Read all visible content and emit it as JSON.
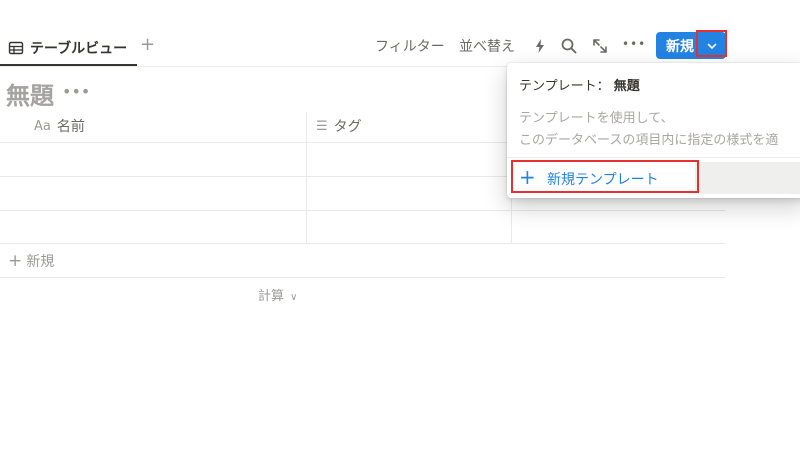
{
  "toolbar": {
    "tab_label": "テーブルビュー",
    "add_view": "+",
    "filter": "フィルター",
    "sort": "並べ替え",
    "new_button": "新規",
    "more": "•••"
  },
  "page": {
    "title": "無題",
    "title_more": "•••"
  },
  "table": {
    "columns": [
      {
        "prefix": "Aa",
        "label": "名前"
      },
      {
        "prefix": "☰",
        "label": "タグ"
      }
    ],
    "new_row_plus": "+",
    "new_row_label": "新規",
    "calculate_label": "計算",
    "calculate_chevron": "∨"
  },
  "template_menu": {
    "head_prefix": "テンプレート：",
    "head_name": "無題",
    "desc_line1": "テンプレートを使用して、",
    "desc_line2": "このデータベースの項目内に指定の様式を適",
    "new_plus": "+",
    "new_template_label": "新規テンプレート"
  },
  "colors": {
    "accent": "#2383e2",
    "highlight": "#e63030",
    "text": "#37352f",
    "muted": "#9b9a97"
  },
  "icons": {
    "tab": "table-icon",
    "automation": "lightning-icon",
    "search": "search-icon",
    "expand": "expand-icon",
    "caret": "chevron-down-icon",
    "tag_column": "list-icon"
  }
}
